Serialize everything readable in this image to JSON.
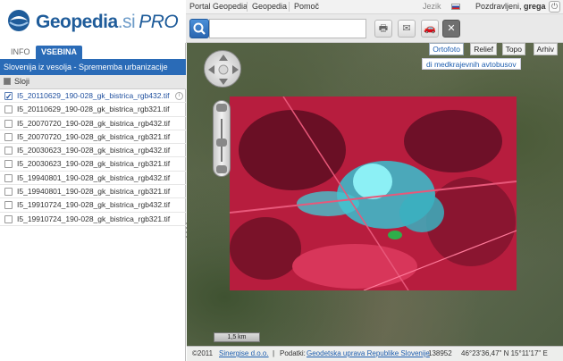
{
  "app": {
    "logo_main": "Geopedia",
    "logo_tld": ".si",
    "logo_pro": "PRO"
  },
  "topnav": {
    "links": [
      "Portal Geopedia",
      "Geopedia",
      "Pomoč"
    ],
    "language_label": "Jezik",
    "greeting": "Pozdravljeni,",
    "username": "grega"
  },
  "search": {
    "placeholder": "",
    "value": ""
  },
  "toolbar": {
    "icons": [
      "print-icon",
      "mail-icon",
      "car-icon",
      "tools-icon"
    ]
  },
  "panel": {
    "tabs": [
      "INFO",
      "VSEBINA"
    ],
    "active_tab": "VSEBINA",
    "theme_title": "Slovenija iz vesolja - Sprememba urbanizacije",
    "layers_header": "Sloji",
    "layers": [
      {
        "name": "I5_20110629_190-028_gk_bistrica_rgb432.tif",
        "checked": true
      },
      {
        "name": "I5_20110629_190-028_gk_bistrica_rgb321.tif",
        "checked": false
      },
      {
        "name": "I5_20070720_190-028_gk_bistrica_rgb432.tif",
        "checked": false
      },
      {
        "name": "I5_20070720_190-028_gk_bistrica_rgb321.tif",
        "checked": false
      },
      {
        "name": "I5_20030623_190-028_gk_bistrica_rgb432.tif",
        "checked": false
      },
      {
        "name": "I5_20030623_190-028_gk_bistrica_rgb321.tif",
        "checked": false
      },
      {
        "name": "I5_19940801_190-028_gk_bistrica_rgb432.tif",
        "checked": false
      },
      {
        "name": "I5_19940801_190-028_gk_bistrica_rgb321.tif",
        "checked": false
      },
      {
        "name": "I5_19910724_190-028_gk_bistrica_rgb432.tif",
        "checked": false
      },
      {
        "name": "I5_19910724_190-028_gk_bistrica_rgb321.tif",
        "checked": false
      }
    ]
  },
  "map": {
    "base_tabs": [
      "Ortofoto",
      "Relief",
      "Topo",
      "Arhiv"
    ],
    "active_base": "Ortofoto",
    "tooltip": "di medkrajevnih avtobusov",
    "scale": "1,5 km"
  },
  "status": {
    "copyright": "©2011",
    "copyright_link": "Sinergise d.o.o.",
    "data_label": "Podatki:",
    "data_link": "Geodetska uprava Republike Slovenije",
    "coords": "138952",
    "latlon": "46°23'36,47\" N 15°11'17\" E"
  },
  "colors": {
    "accent": "#2a6bb7",
    "raster_vegetation": "#d02448",
    "raster_urban": "#4fd4df"
  }
}
